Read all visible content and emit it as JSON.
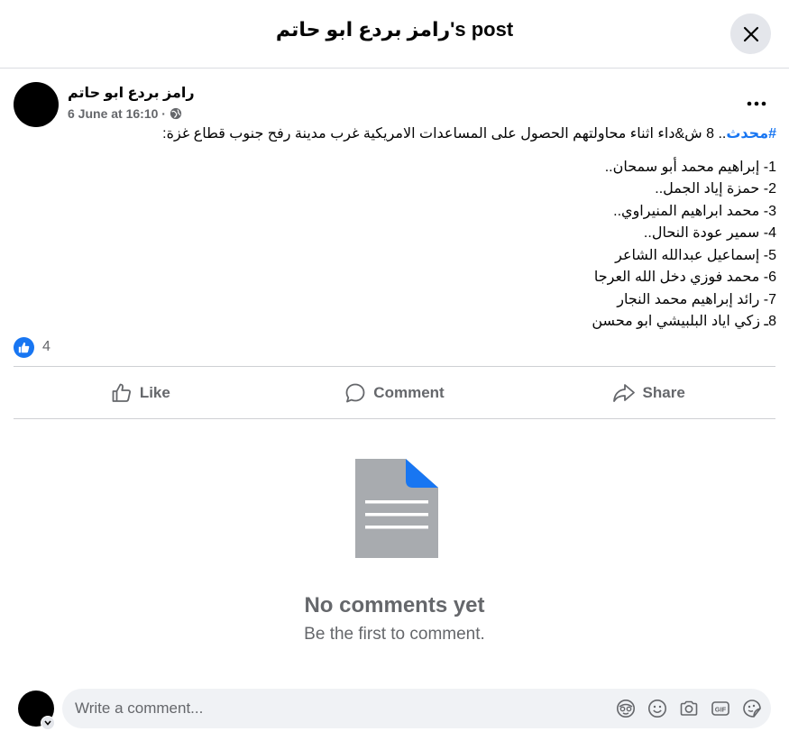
{
  "dialog": {
    "title": "رامز بردع ابو حاتم's post"
  },
  "post": {
    "author": "رامز بردع ابو حاتم",
    "timestamp": "6 June at 16:10 ·",
    "hashtag": "#محدث",
    "intro": ".. 8 ش&داء اثناء محاولتهم الحصول على المساعدات الامريكية غرب مدينة رفح جنوب قطاع غزة:",
    "lines": [
      "1- إبراهيم محمد أبو سمحان..",
      "2- حمزة إياد الجمل..",
      "3- محمد ابراهيم المنيراوي..",
      "4- سمير عودة النحال..",
      "5- إسماعيل عبدالله الشاعر",
      "6- محمد فوزي دخل الله العرجا",
      "7- رائد إبراهيم محمد النجار",
      "8ـ زكي اياد البلبيشي ابو محسن"
    ],
    "reaction_count": "4"
  },
  "actions": {
    "like": "Like",
    "comment": "Comment",
    "share": "Share"
  },
  "empty_state": {
    "title": "No comments yet",
    "subtitle": "Be the first to comment."
  },
  "composer": {
    "placeholder": "Write a comment...",
    "tools": [
      "avatar-sticker-icon",
      "emoji-icon",
      "camera-icon",
      "gif-icon",
      "sticker-icon"
    ]
  },
  "colors": {
    "accent": "#1876f2",
    "muted": "#65676b",
    "surface": "#f0f2f5"
  }
}
